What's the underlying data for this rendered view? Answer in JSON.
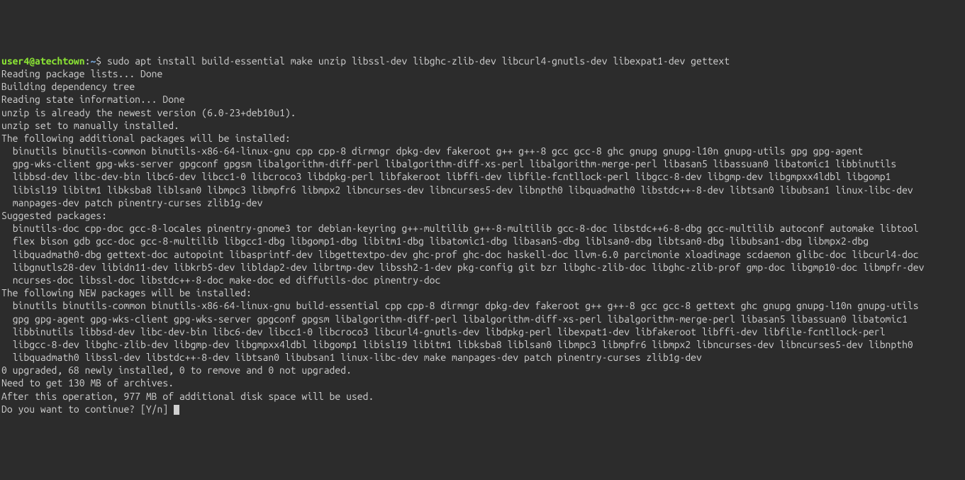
{
  "prompt": {
    "user": "user4@atechtown",
    "colon": ":",
    "path": "~",
    "dollar": "$ "
  },
  "command": "sudo apt install build-essential make unzip libssl-dev libghc-zlib-dev libcurl4-gnutls-dev libexpat1-dev gettext",
  "output": {
    "l1": "Reading package lists... Done",
    "l2": "Building dependency tree",
    "l3": "Reading state information... Done",
    "l4": "unzip is already the newest version (6.0-23+deb10u1).",
    "l5": "unzip set to manually installed.",
    "l6": "The following additional packages will be installed:",
    "l7": "  binutils binutils-common binutils-x86-64-linux-gnu cpp cpp-8 dirmngr dpkg-dev fakeroot g++ g++-8 gcc gcc-8 ghc gnupg gnupg-l10n gnupg-utils gpg gpg-agent",
    "l8": "  gpg-wks-client gpg-wks-server gpgconf gpgsm libalgorithm-diff-perl libalgorithm-diff-xs-perl libalgorithm-merge-perl libasan5 libassuan0 libatomic1 libbinutils",
    "l9": "  libbsd-dev libc-dev-bin libc6-dev libcc1-0 libcroco3 libdpkg-perl libfakeroot libffi-dev libfile-fcntllock-perl libgcc-8-dev libgmp-dev libgmpxx4ldbl libgomp1",
    "l10": "  libisl19 libitm1 libksba8 liblsan0 libmpc3 libmpfr6 libmpx2 libncurses-dev libncurses5-dev libnpth0 libquadmath0 libstdc++-8-dev libtsan0 libubsan1 linux-libc-dev",
    "l11": "  manpages-dev patch pinentry-curses zlib1g-dev",
    "l12": "Suggested packages:",
    "l13": "  binutils-doc cpp-doc gcc-8-locales pinentry-gnome3 tor debian-keyring g++-multilib g++-8-multilib gcc-8-doc libstdc++6-8-dbg gcc-multilib autoconf automake libtool",
    "l14": "  flex bison gdb gcc-doc gcc-8-multilib libgcc1-dbg libgomp1-dbg libitm1-dbg libatomic1-dbg libasan5-dbg liblsan0-dbg libtsan0-dbg libubsan1-dbg libmpx2-dbg",
    "l15": "  libquadmath0-dbg gettext-doc autopoint libasprintf-dev libgettextpo-dev ghc-prof ghc-doc haskell-doc llvm-6.0 parcimonie xloadimage scdaemon glibc-doc libcurl4-doc",
    "l16": "  libgnutls28-dev libidn11-dev libkrb5-dev libldap2-dev librtmp-dev libssh2-1-dev pkg-config git bzr libghc-zlib-doc libghc-zlib-prof gmp-doc libgmp10-doc libmpfr-dev",
    "l17": "  ncurses-doc libssl-doc libstdc++-8-doc make-doc ed diffutils-doc pinentry-doc",
    "l18": "The following NEW packages will be installed:",
    "l19": "  binutils binutils-common binutils-x86-64-linux-gnu build-essential cpp cpp-8 dirmngr dpkg-dev fakeroot g++ g++-8 gcc gcc-8 gettext ghc gnupg gnupg-l10n gnupg-utils",
    "l20": "  gpg gpg-agent gpg-wks-client gpg-wks-server gpgconf gpgsm libalgorithm-diff-perl libalgorithm-diff-xs-perl libalgorithm-merge-perl libasan5 libassuan0 libatomic1",
    "l21": "  libbinutils libbsd-dev libc-dev-bin libc6-dev libcc1-0 libcroco3 libcurl4-gnutls-dev libdpkg-perl libexpat1-dev libfakeroot libffi-dev libfile-fcntllock-perl",
    "l22": "  libgcc-8-dev libghc-zlib-dev libgmp-dev libgmpxx4ldbl libgomp1 libisl19 libitm1 libksba8 liblsan0 libmpc3 libmpfr6 libmpx2 libncurses-dev libncurses5-dev libnpth0",
    "l23": "  libquadmath0 libssl-dev libstdc++-8-dev libtsan0 libubsan1 linux-libc-dev make manpages-dev patch pinentry-curses zlib1g-dev",
    "l24": "0 upgraded, 68 newly installed, 0 to remove and 0 not upgraded.",
    "l25": "Need to get 130 MB of archives.",
    "l26": "After this operation, 977 MB of additional disk space will be used.",
    "l27": "Do you want to continue? [Y/n] "
  }
}
